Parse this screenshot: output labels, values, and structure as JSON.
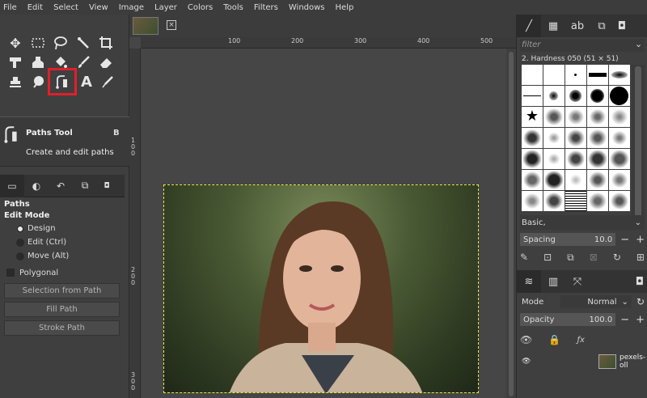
{
  "menu": [
    "File",
    "Edit",
    "Select",
    "View",
    "Image",
    "Layer",
    "Colors",
    "Tools",
    "Filters",
    "Windows",
    "Help"
  ],
  "tooltip": {
    "title": "Paths Tool",
    "shortcut": "B",
    "description": "Create and edit paths"
  },
  "tool_options": {
    "heading": "Paths",
    "edit_mode_label": "Edit Mode",
    "modes": [
      "Design",
      "Edit (Ctrl)",
      "Move (Alt)"
    ],
    "selected_mode": "Design",
    "polygonal_label": "Polygonal",
    "buttons": [
      "Selection from Path",
      "Fill Path",
      "Stroke Path"
    ]
  },
  "rulers": {
    "horizontal": [
      "100",
      "200",
      "300",
      "400",
      "500"
    ],
    "vertical": [
      "100",
      "200",
      "300"
    ]
  },
  "brushes": {
    "filter_placeholder": "filter",
    "current": "2. Hardness 050 (51 × 51)",
    "preset": "Basic,",
    "spacing_label": "Spacing",
    "spacing_value": "10.0"
  },
  "layers": {
    "mode_label": "Mode",
    "mode_value": "Normal",
    "opacity_label": "Opacity",
    "opacity_value": "100.0",
    "layer_name": "pexels-oll"
  },
  "colors": {
    "highlight": "#e0202a",
    "selection": "#e8e84a"
  }
}
